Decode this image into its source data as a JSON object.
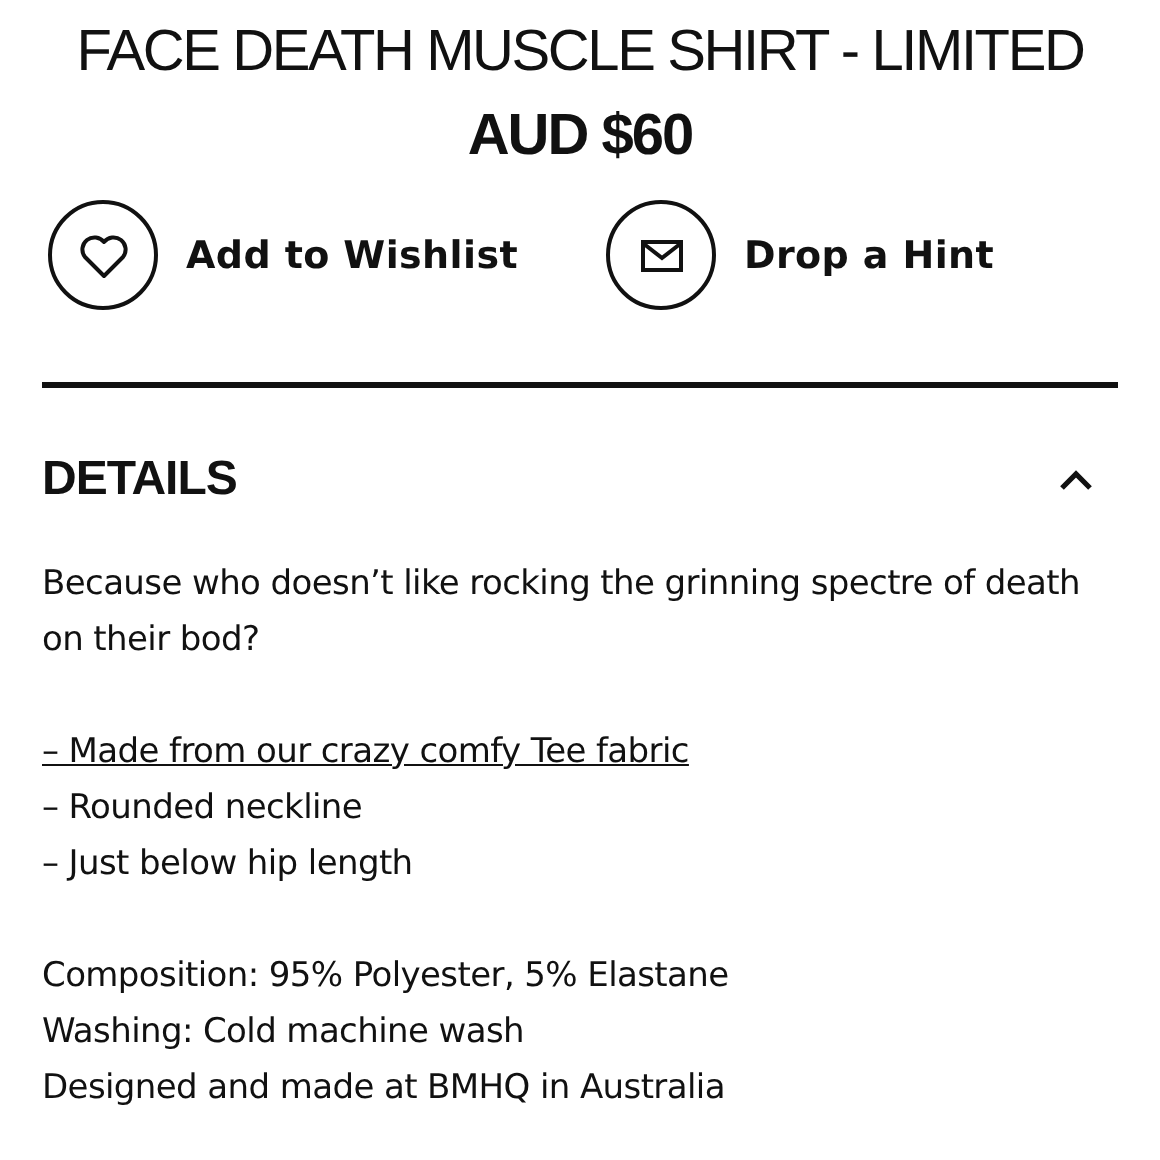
{
  "product": {
    "title": "FACE DEATH MUSCLE SHIRT - LIMITED",
    "price": "AUD $60"
  },
  "actions": [
    {
      "kind": "wishlist",
      "label": "Add to Wishlist"
    },
    {
      "kind": "hint",
      "label": "Drop a Hint"
    }
  ],
  "details": {
    "heading": "DETAILS",
    "expanded": true,
    "paragraphs": [
      [
        {
          "kind": "text",
          "text": "Because who doesn’t like rocking the grinning spectre of death on their bod?"
        }
      ],
      [
        {
          "kind": "link",
          "text": "– Made from our crazy comfy Tee fabric"
        },
        {
          "kind": "text",
          "text": "– Rounded neckline"
        },
        {
          "kind": "text",
          "text": "– Just below hip length"
        }
      ],
      [
        {
          "kind": "text",
          "text": "Composition: 95% Polyester, 5% Elastane"
        },
        {
          "kind": "text",
          "text": "Washing: Cold machine wash"
        },
        {
          "kind": "text",
          "text": "Designed and made at BMHQ in Australia"
        }
      ]
    ]
  }
}
